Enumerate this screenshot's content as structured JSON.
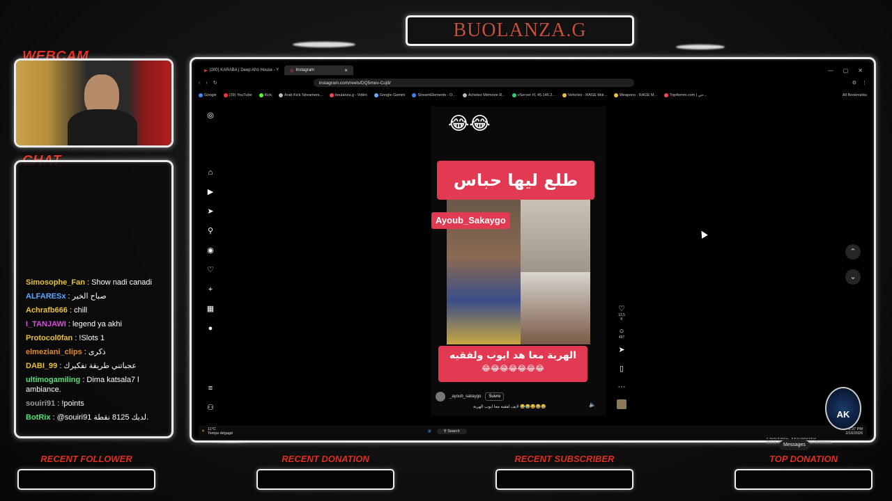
{
  "overlay": {
    "title": "BUOLANZA.G",
    "webcam_label": "WEBCAM",
    "chat_label": "CHAT",
    "bottom_labels": [
      "RECENT FOLLOWER",
      "RECENT DONATION",
      "RECENT SUBSCRIBER",
      "TOP DONATION"
    ],
    "badge_text": "AK"
  },
  "chat": [
    {
      "user": "Simosophe_Fan",
      "color": "#e8c23a",
      "message": "Show nadi canadi"
    },
    {
      "user": "ALFARESx",
      "color": "#5aa8ff",
      "message": "صباح الخير"
    },
    {
      "user": "Achrafb666",
      "color": "#e8c23a",
      "message": "chill"
    },
    {
      "user": "I_TANJAWI",
      "color": "#d94de0",
      "message": "legend ya akhi"
    },
    {
      "user": "Protocol0fan",
      "color": "#e8c23a",
      "message": "!Slots 1"
    },
    {
      "user": "elmeziani_clips",
      "color": "#e08b2a",
      "message": "ذكرى"
    },
    {
      "user": "DABI_99",
      "color": "#e8c23a",
      "message": "عجباتني طريقة تفكيرك"
    },
    {
      "user": "ultimogamiling",
      "color": "#55e07a",
      "message": "Dima katsala7 l ambiance."
    },
    {
      "user": "souiri91",
      "color": "#9a9a9a",
      "message": "!points"
    },
    {
      "user": "BotRix",
      "color": "#55e07a",
      "message": "@souiri91 لديك 8125 نقطة."
    }
  ],
  "browser": {
    "tabs": [
      "(200) KARABA | Deep Afro House - Y",
      "Instagram"
    ],
    "url": "instagram.com/reels/DQ5mev-Cuj8/",
    "bookmarks": [
      "Google",
      "(39) YouTube",
      "Kick",
      "Arab Kick Streamers...",
      "boulanza.g - Vidéo",
      "Google Gemini",
      "StreamElements - O...",
      "Achetez Mémoire R...",
      "vServer #1 45.146.2...",
      "Vehicles - RAGE Mul...",
      "Weapons - RAGE M...",
      "Top4emm.com | حي..."
    ],
    "all_bookmarks": "All Bookmarks"
  },
  "reel": {
    "top_emoji": "😂😂",
    "title_arabic": "طلع ليها حباس",
    "name_tag": "Ayoub_Sakaygo",
    "caption_arabic": "الهربة معا هد ايوب ولفقيه",
    "caption_emojis": "😂😂😂😂😂😂😂",
    "account": "_ayoub_sakaygo",
    "follow": "Suivre",
    "description": "لايف لفقيه معا ايوب الهربة 😂😂😂😂😂",
    "likes": "13,5 K",
    "comments": "497"
  },
  "system": {
    "activate_title": "Activate Windows",
    "activate_sub": "Go to Settings to activate Windows.",
    "messages": "Messages",
    "weather_temp": "11°C",
    "weather_desc": "Temps dégagé",
    "search": "Search",
    "time": "2:37 PM",
    "date": "2/16/2026"
  }
}
